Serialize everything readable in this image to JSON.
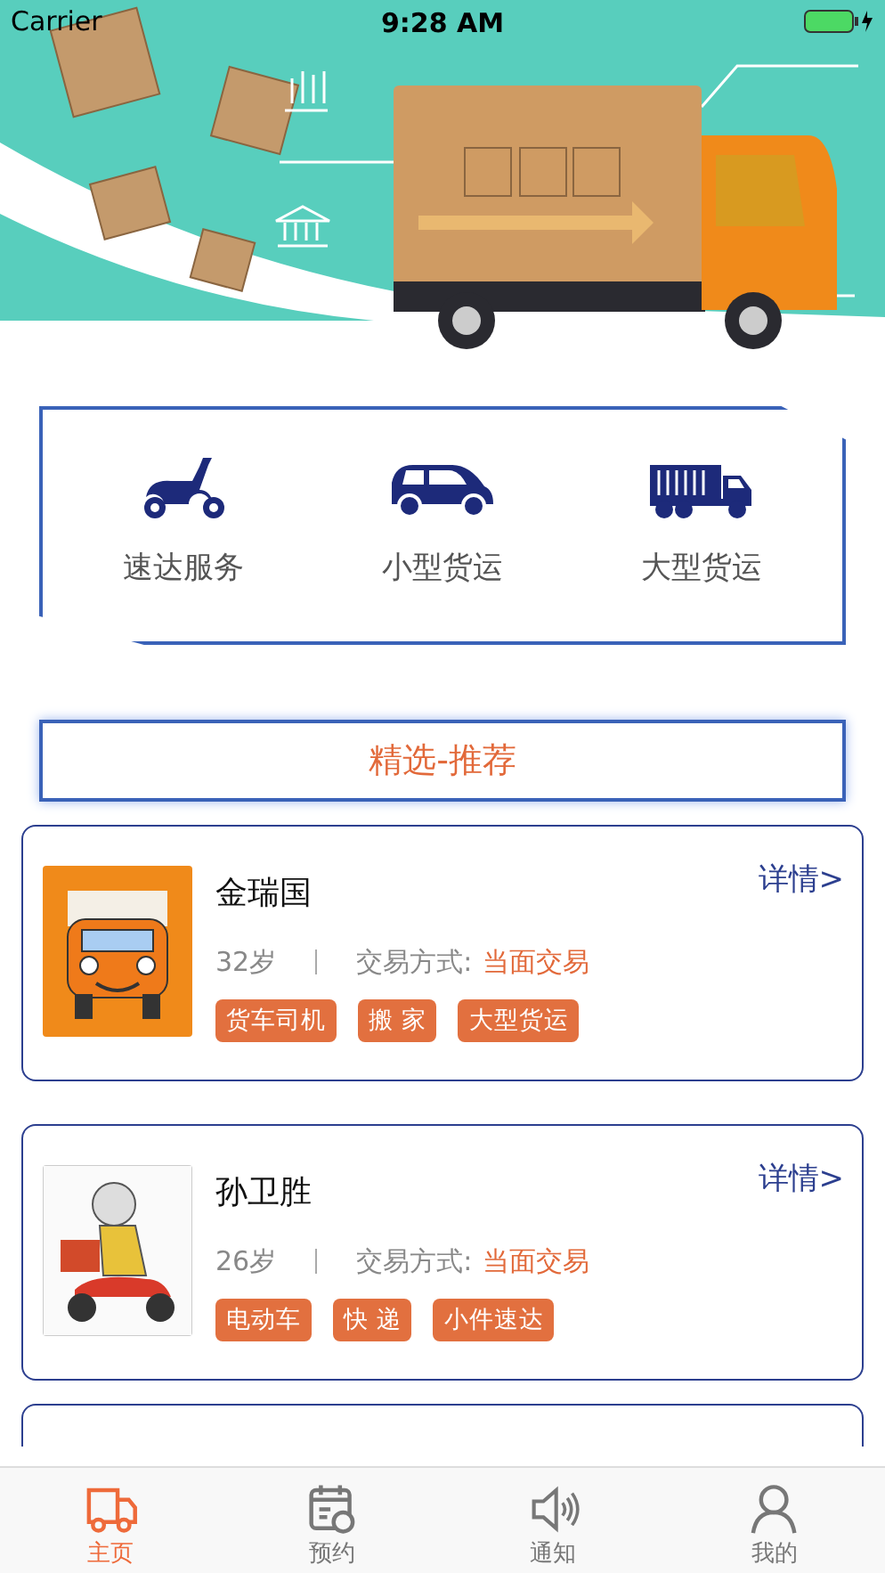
{
  "status_bar": {
    "carrier": "Carrier",
    "time": "9:28 AM"
  },
  "services": [
    {
      "kind": "scooter",
      "label": "速达服务"
    },
    {
      "kind": "car",
      "label": "小型货运"
    },
    {
      "kind": "truck",
      "label": "大型货运"
    }
  ],
  "section_title": "精选-推荐",
  "drivers": [
    {
      "kind": "truck",
      "name": "金瑞国",
      "age": "32岁",
      "trade_label": "交易方式:",
      "trade_value": "当面交易",
      "detail": "详情>",
      "tags": [
        "货车司机",
        "搬 家",
        "大型货运"
      ]
    },
    {
      "kind": "courier",
      "name": "孙卫胜",
      "age": "26岁",
      "trade_label": "交易方式:",
      "trade_value": "当面交易",
      "detail": "详情>",
      "tags": [
        "电动车",
        "快 递",
        "小件速达"
      ]
    }
  ],
  "tab_bar": [
    {
      "kind": "truck",
      "label": "主页",
      "selected": true
    },
    {
      "kind": "calendar",
      "label": "预约",
      "selected": false
    },
    {
      "kind": "speaker",
      "label": "通知",
      "selected": false
    },
    {
      "kind": "person",
      "label": "我的",
      "selected": false
    }
  ]
}
